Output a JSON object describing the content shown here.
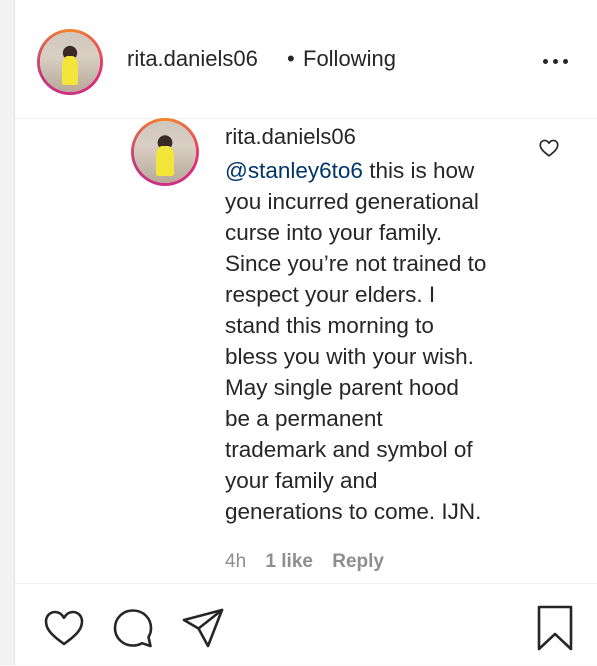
{
  "header": {
    "username": "rita.daniels06",
    "separator": "•",
    "follow_state": "Following",
    "more_icon": "more-horizontal-icon"
  },
  "comment": {
    "author": "rita.daniels06",
    "mention": "@stanley6to6",
    "lines": [
      " this is how",
      "you incurred generational",
      "curse into your family.",
      "Since you’re not trained to",
      "respect your elders. I",
      "stand this morning to",
      "bless you with your wish.",
      "May single parent hood",
      "be a permanent",
      "trademark and symbol of",
      "your family and",
      "generations to come. IJN."
    ],
    "time": "4h",
    "likes": "1 like",
    "reply_label": "Reply",
    "like_icon": "heart-outline-icon"
  },
  "action_bar": {
    "icons": [
      "heart-icon",
      "comment-bubble-icon",
      "share-paper-plane-icon",
      "bookmark-icon"
    ]
  },
  "colors": {
    "mention": "#003569",
    "meta": "#8e8e8e",
    "text": "#262626"
  }
}
